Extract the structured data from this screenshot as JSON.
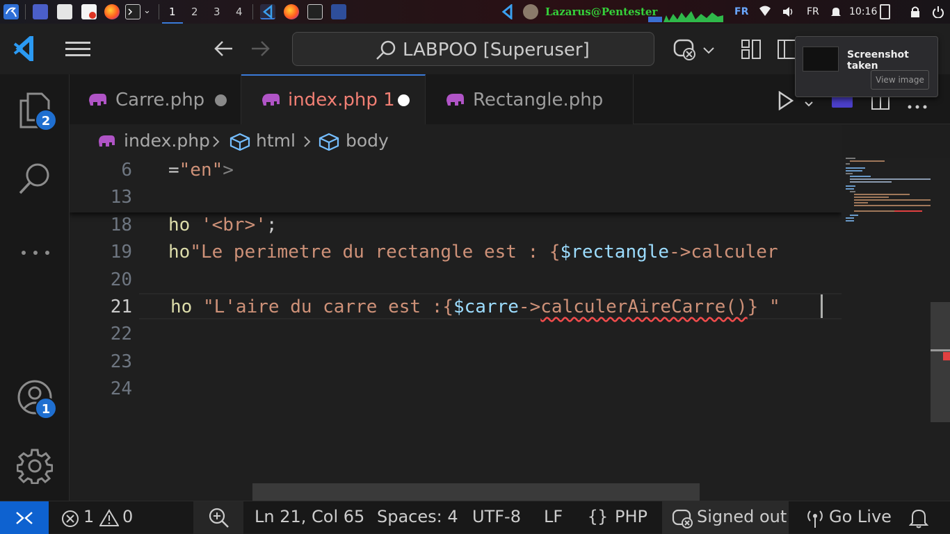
{
  "taskbar": {
    "workspaces": [
      "1",
      "2",
      "3",
      "4"
    ],
    "user": "Lazarus@Pentester",
    "keyboard_layout": "FR",
    "locale": "FR",
    "time": "10:16"
  },
  "titlebar": {
    "search_label": "LABPOO [Superuser]"
  },
  "activity": {
    "explorer_badge": "2",
    "accounts_badge": "1"
  },
  "tabs": [
    {
      "label": "Carre.php",
      "modified": true
    },
    {
      "label": "index.php 1",
      "modified": true,
      "active": true
    },
    {
      "label": "Rectangle.php",
      "modified": false
    }
  ],
  "breadcrumb": [
    "index.php",
    "html",
    "body"
  ],
  "editor": {
    "lines": [
      {
        "number": "6",
        "text": "=\"en\">"
      },
      {
        "number": "13",
        "text": ""
      },
      {
        "number": "18",
        "text": "ho '<br>';"
      },
      {
        "number": "19",
        "text": "ho\"Le perimetre du rectangle est : {$rectangle->calculer"
      },
      {
        "number": "20",
        "text": ""
      },
      {
        "number": "21",
        "text": "ho \"L'aire du carre est :{$carre->calculerAireCarre()} \""
      },
      {
        "number": "22",
        "text": ""
      },
      {
        "number": "23",
        "text": ""
      },
      {
        "number": "24",
        "text": ""
      }
    ],
    "code_parts": {
      "l6_a": "=",
      "l6_b": "\"en\"",
      "l6_c": ">",
      "l18_a": "ho ",
      "l18_b": "'<br>'",
      "l18_c": ";",
      "l19_a": "ho",
      "l19_b": "\"Le perimetre du rectangle est : {",
      "l19_c": "$rectangle",
      "l19_d": "->calculer",
      "l21_a": "ho ",
      "l21_b": "\"L'aire du carre est :{",
      "l21_c": "$carre",
      "l21_d": "->",
      "l21_e": "calculerAireCarre()",
      "l21_f": "}",
      "l21_g": " \""
    }
  },
  "notification": {
    "title": "Screenshot taken",
    "action": "View image"
  },
  "status": {
    "errors": "1",
    "warnings": "0",
    "position": "Ln 21, Col 65",
    "spaces": "Spaces: 4",
    "encoding": "UTF-8",
    "eol": "LF",
    "language": "PHP",
    "account": "Signed out",
    "live": "Go Live"
  },
  "colors": {
    "accent": "#3a7ad9",
    "string": "#ce9178",
    "variable": "#9cdcfe",
    "active_tab_text": "#f17f74",
    "user_label": "#35d13a"
  }
}
